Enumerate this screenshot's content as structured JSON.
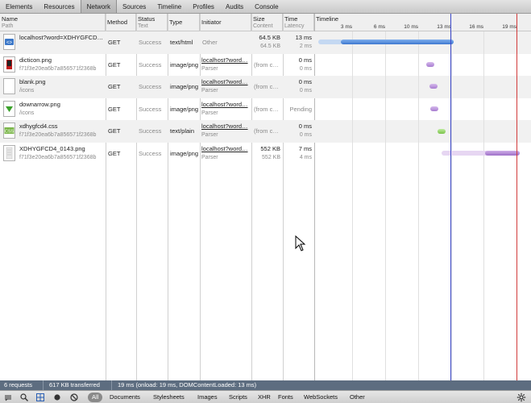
{
  "panel_tabs": [
    "Elements",
    "Resources",
    "Network",
    "Sources",
    "Timeline",
    "Profiles",
    "Audits",
    "Console"
  ],
  "active_tab": "Network",
  "columns": {
    "name": {
      "label": "Name",
      "sub": "Path"
    },
    "method": {
      "label": "Method"
    },
    "status": {
      "label": "Status",
      "sub": "Text"
    },
    "type": {
      "label": "Type"
    },
    "initiator": {
      "label": "Initiator"
    },
    "size": {
      "label": "Size",
      "sub": "Content"
    },
    "time": {
      "label": "Time",
      "sub": "Latency"
    },
    "timeline": {
      "label": "Timeline"
    }
  },
  "ticks": [
    "3 ms",
    "6 ms",
    "10 ms",
    "13 ms",
    "16 ms",
    "19 ms"
  ],
  "requests": [
    {
      "name": "localhost?word=XDHYGFCD…",
      "path": "",
      "method": "GET",
      "status": "Success",
      "type": "text/html",
      "initiator": "Other",
      "initiator_sub": "",
      "size": "64.5 KB",
      "size_sub": "64.5 KB",
      "time": "13 ms",
      "time_sub": "2 ms",
      "icon": "html-file-icon"
    },
    {
      "name": "dicticon.png",
      "path": "f71f3e20ea6b7a856571f2368b",
      "method": "GET",
      "status": "Success",
      "type": "image/png",
      "initiator": "localhost?word…",
      "initiator_sub": "Parser",
      "size": "(from c…",
      "size_sub": "",
      "time": "0 ms",
      "time_sub": "0 ms",
      "icon": "dict-image-icon"
    },
    {
      "name": "blank.png",
      "path": "/icons",
      "method": "GET",
      "status": "Success",
      "type": "image/png",
      "initiator": "localhost?word…",
      "initiator_sub": "Parser",
      "size": "(from c…",
      "size_sub": "",
      "time": "0 ms",
      "time_sub": "0 ms",
      "icon": "blank-image-icon"
    },
    {
      "name": "downarrow.png",
      "path": "/icons",
      "method": "GET",
      "status": "Success",
      "type": "image/png",
      "initiator": "localhost?word…",
      "initiator_sub": "Parser",
      "size": "(from c…",
      "size_sub": "",
      "time": "Pending",
      "time_sub": "",
      "icon": "down-arrow-image-icon"
    },
    {
      "name": "xdhygfcd4.css",
      "path": "f71f3e20ea6b7a856571f2368b",
      "method": "GET",
      "status": "Success",
      "type": "text/plain",
      "initiator": "localhost?word…",
      "initiator_sub": "Parser",
      "size": "(from c…",
      "size_sub": "",
      "time": "0 ms",
      "time_sub": "0 ms",
      "icon": "css-file-icon"
    },
    {
      "name": "XDHYGFCD4_0143.png",
      "path": "f71f3e20ea6b7a856571f2368b",
      "method": "GET",
      "status": "Success",
      "type": "image/png",
      "initiator": "localhost?word…",
      "initiator_sub": "Parser",
      "size": "552 KB",
      "size_sub": "552 KB",
      "time": "7 ms",
      "time_sub": "4 ms",
      "icon": "image-file-icon"
    }
  ],
  "status": {
    "requests": "6 requests",
    "transferred": "617 KB transferred",
    "timing": "19 ms (onload: 19 ms, DOMContentLoaded: 13 ms)"
  },
  "filters": [
    "All",
    "Documents",
    "Stylesheets",
    "Images",
    "Scripts",
    "XHR",
    "Fonts",
    "WebSockets",
    "Other"
  ],
  "selected_filter": "All",
  "colors": {
    "accent_blue": "#4a86d8",
    "image_purple": "#b78bd6",
    "css_green": "#8fd16b",
    "dom_line": "#3b47c9",
    "load_line": "#d23a3a",
    "statusbar": "#5d6d80"
  }
}
